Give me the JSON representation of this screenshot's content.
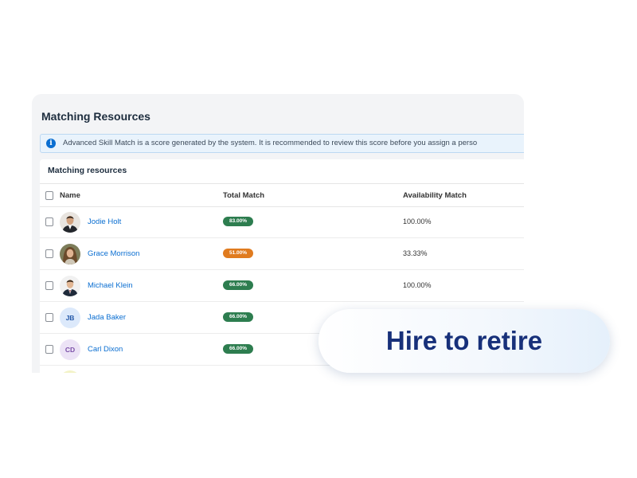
{
  "card": {
    "title": "Matching Resources",
    "info_text": "Advanced Skill Match is a score generated by the system. It is recommended to review this score before you assign a perso"
  },
  "panel": {
    "title": "Matching resources",
    "columns": [
      "Name",
      "Total Match",
      "Availability Match"
    ]
  },
  "rows": [
    {
      "name": "Jodie Holt",
      "match": "83.00%",
      "match_status": "green",
      "availability": "100.00%",
      "avatar": "photo"
    },
    {
      "name": "Grace Morrison",
      "match": "51.00%",
      "match_status": "orange",
      "availability": "33.33%",
      "avatar": "photo"
    },
    {
      "name": "Michael Klein",
      "match": "66.00%",
      "match_status": "green",
      "availability": "100.00%",
      "avatar": "photo"
    },
    {
      "name": "Jada Baker",
      "match": "66.00%",
      "match_status": "green",
      "availability": "",
      "avatar": "initials",
      "initials": "JB"
    },
    {
      "name": "Carl Dixon",
      "match": "66.00%",
      "match_status": "green",
      "availability": "",
      "avatar": "initials",
      "initials": "CD"
    }
  ],
  "banner": {
    "text": "Hire to retire"
  },
  "colors": {
    "link": "#0a6ed1",
    "badge_green": "#2d7d4f",
    "badge_orange": "#e07b1f",
    "banner_text": "#17307a"
  }
}
